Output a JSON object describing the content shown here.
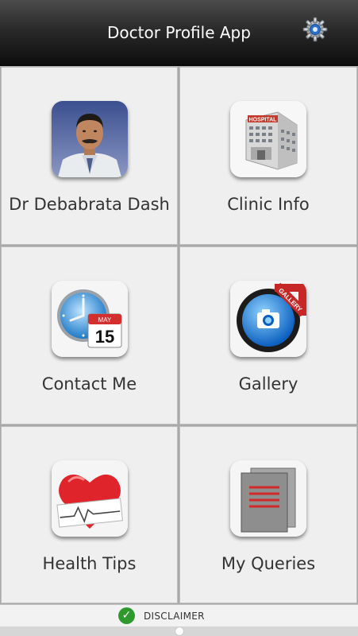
{
  "header": {
    "title": "Doctor Profile App",
    "settings_icon": "gear-icon"
  },
  "tiles": [
    {
      "label": "Dr Debabrata Dash",
      "icon": "doctor-photo-icon"
    },
    {
      "label": "Clinic Info",
      "icon": "hospital-building-icon",
      "icon_text": "HOSPITAL"
    },
    {
      "label": "Contact Me",
      "icon": "clock-calendar-icon",
      "month": "MAY",
      "day": "15"
    },
    {
      "label": "Gallery",
      "icon": "camera-icon",
      "ribbon": "GALLERY"
    },
    {
      "label": "Health Tips",
      "icon": "heart-icon"
    },
    {
      "label": "My Queries",
      "icon": "documents-icon"
    }
  ],
  "footer": {
    "disclaimer": "DISCLAIMER"
  },
  "colors": {
    "appbar": "#1a1a1a",
    "tile_bg": "#efefef",
    "check": "#2e9a2e"
  }
}
